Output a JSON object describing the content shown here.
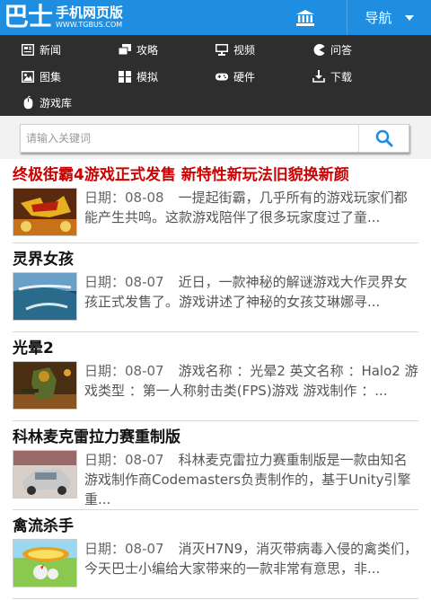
{
  "header": {
    "logo_main": "巴士",
    "logo_sub": "手机网页版",
    "logo_url": "WWW.TGBUS.COM",
    "home_icon": "bank-icon",
    "nav_label": "导航",
    "colors": {
      "brand_blue": "#1f8ee0",
      "menu_bg": "#2e2e2e",
      "hot_title": "#cc0000"
    }
  },
  "menu": {
    "items": [
      {
        "label": "新闻",
        "icon": "news-icon"
      },
      {
        "label": "攻略",
        "icon": "copy-icon"
      },
      {
        "label": "视频",
        "icon": "monitor-icon"
      },
      {
        "label": "问答",
        "icon": "pacman-icon"
      },
      {
        "label": "图集",
        "icon": "album-icon"
      },
      {
        "label": "模拟",
        "icon": "joystick-icon"
      },
      {
        "label": "硬件",
        "icon": "gamepad-icon"
      },
      {
        "label": "下载",
        "icon": "download-icon"
      },
      {
        "label": "游戏库",
        "icon": "mouse-icon"
      }
    ]
  },
  "search": {
    "placeholder": "请输入关键词",
    "value": "",
    "icon": "search-icon"
  },
  "articles": [
    {
      "title": "终极街霸4游戏正式发售 新特性新玩法旧貌换新颜",
      "date": "日期：08-08",
      "summary": "一提起街霸，几乎所有的游戏玩家们都能产生共鸣。这款游戏陪伴了很多玩家度过了童...",
      "hot": true
    },
    {
      "title": "灵界女孩",
      "date": "日期：08-07",
      "summary": "近日，一款神秘的解谜游戏大作灵界女孩正式发售了。游戏讲述了神秘的女孩艾琳娜寻...",
      "hot": false
    },
    {
      "title": "光晕2",
      "date": "日期：08-07",
      "summary": "游戏名称 ：光晕2 英文名称 ：Halo2 游戏类型 ：第一人称射击类(FPS)游戏 游戏制作 ：...",
      "hot": false
    },
    {
      "title": "科林麦克雷拉力赛重制版",
      "date": "日期：08-07",
      "summary": "科林麦克雷拉力赛重制版是一款由知名游戏制作商Codemasters负责制作的，基于Unity引擎重...",
      "hot": false
    },
    {
      "title": "禽流杀手",
      "date": "日期：08-07",
      "summary": "消灭H7N9，消灭带病毒入侵的禽类们，今天巴士小编给大家带来的一款非常有意思，非...",
      "hot": false
    }
  ]
}
